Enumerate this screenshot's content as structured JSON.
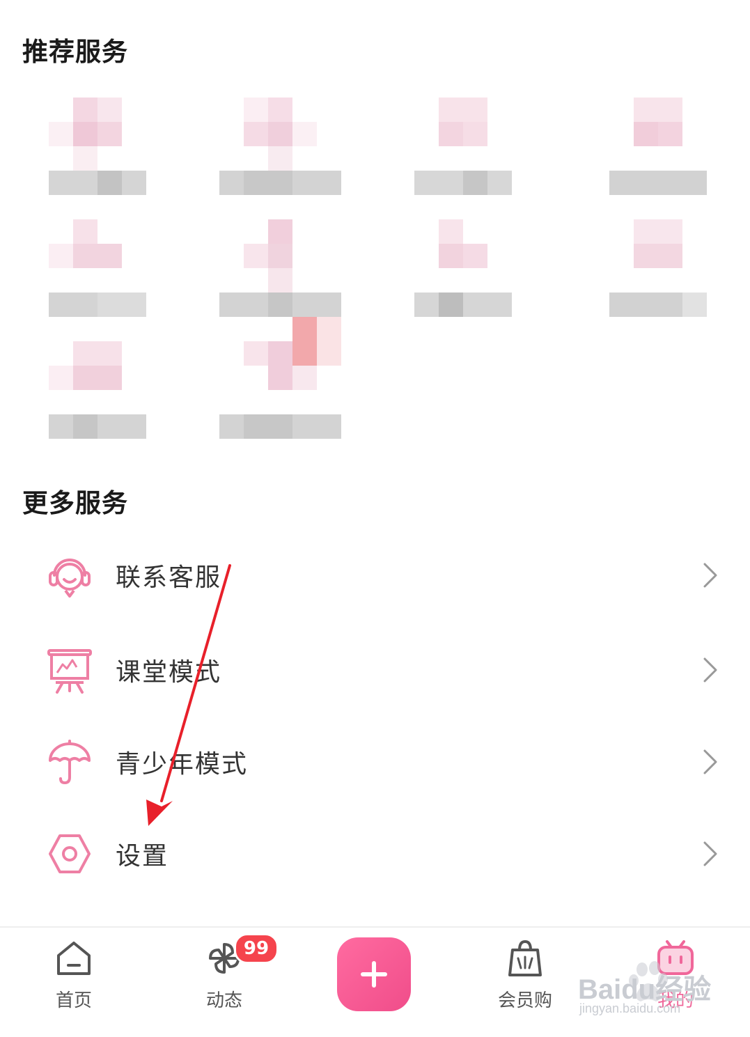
{
  "sections": {
    "recommended_title": "推荐服务",
    "more_title": "更多服务"
  },
  "more_services": [
    {
      "label": "联系客服",
      "icon": "headset-icon"
    },
    {
      "label": "课堂模式",
      "icon": "presentation-board-icon"
    },
    {
      "label": "青少年模式",
      "icon": "umbrella-icon"
    },
    {
      "label": "设置",
      "icon": "hexagon-settings-icon"
    }
  ],
  "bottom_nav": {
    "home": "首页",
    "dynamics": "动态",
    "dynamics_badge": "99",
    "vip_shop": "会员购",
    "mine": "我的"
  },
  "watermark": {
    "brand": "Baidu经验",
    "url": "jingyan.baidu.com"
  },
  "colors": {
    "accent": "#f0679a",
    "icon_pink": "#ee7fa4",
    "badge_red": "#f5444d",
    "arrow_red": "#e8202a"
  }
}
